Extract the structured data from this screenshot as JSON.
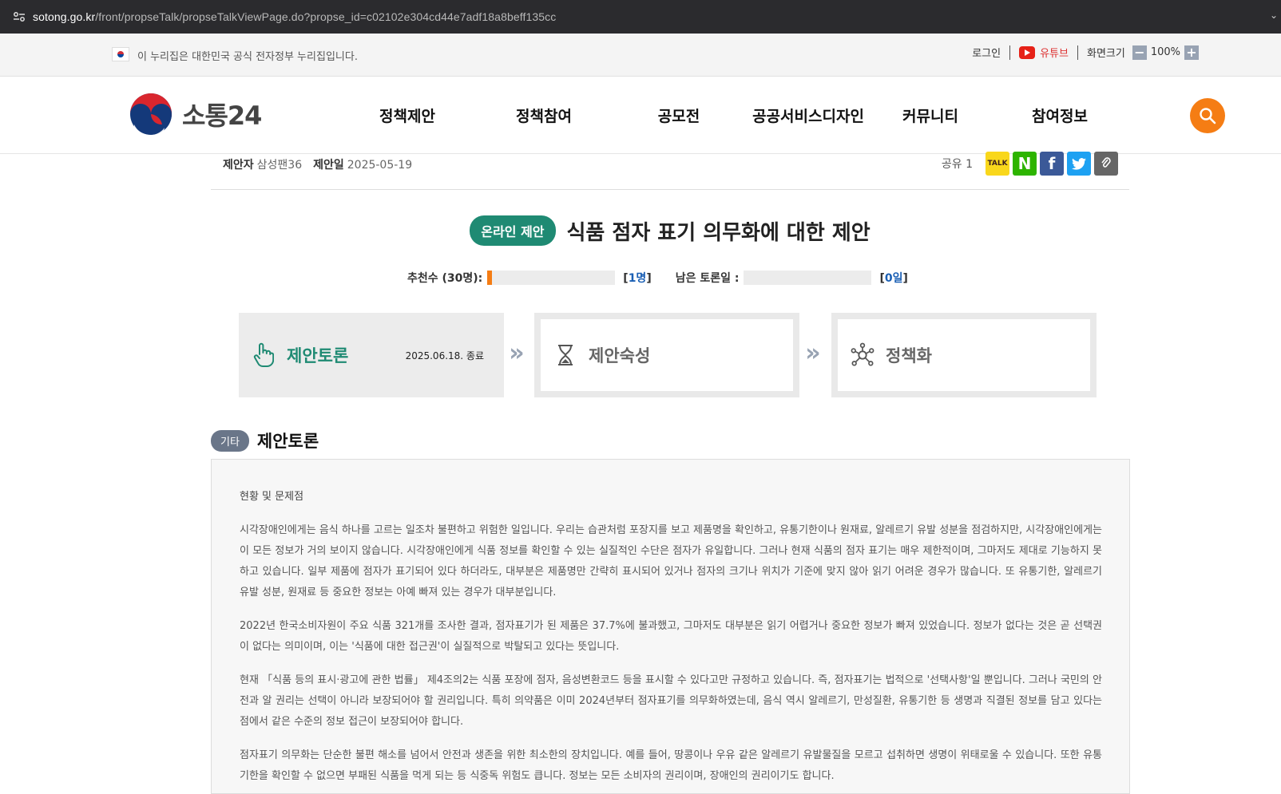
{
  "browser": {
    "url_host": "sotong.go.kr",
    "url_path": "/front/propseTalk/propseTalkViewPage.do?propse_id=c02102e304cd44e7adf18a8beff135cc"
  },
  "govbar": {
    "text": "이 누리집은 대한민국 공식 전자정부 누리집입니다.",
    "login": "로그인",
    "youtube": "유튜브",
    "zoom_label": "화면크기",
    "zoom_minus": "−",
    "zoom_value": "100%",
    "zoom_plus": "+"
  },
  "header": {
    "brand": "소통24",
    "nav": [
      "정책제안",
      "정책참여",
      "공모전",
      "공공서비스디자인",
      "커뮤니티",
      "참여정보"
    ],
    "search_icon": "search-icon"
  },
  "meta": {
    "proposer_label": "제안자",
    "proposer": "삼성팬36",
    "date_label": "제안일",
    "date": "2025-05-19",
    "share_label": "공유",
    "share_count": "1",
    "share_icons": [
      "kakaotalk-icon",
      "naver-icon",
      "facebook-icon",
      "twitter-icon",
      "link-icon"
    ],
    "kakao_text": "TALK",
    "naver_text": "N",
    "facebook_text": "f"
  },
  "proposal": {
    "type_badge": "온라인 제안",
    "title": "식품 점자 표기 의무화에 대한 제안"
  },
  "stats": {
    "recommend_label": "추천수 (30명):",
    "recommend_open": "[",
    "recommend_count": "1명",
    "recommend_close": "]",
    "recommend_progress": 0.033,
    "remaining_label": "남은 토론일 :",
    "remaining_open": "[",
    "remaining_count": "0일",
    "remaining_close": "]",
    "remaining_progress": 0
  },
  "stages": [
    {
      "name": "제안토론",
      "date": "2025.06.18. 종료",
      "state": "active",
      "icon": "hand-pointer-icon"
    },
    {
      "name": "제안숙성",
      "date": "",
      "state": "inactive",
      "icon": "hourglass-icon"
    },
    {
      "name": "정책화",
      "date": "",
      "state": "inactive",
      "icon": "network-icon"
    }
  ],
  "arrow_glyph": "»",
  "section": {
    "category": "기타",
    "title": "제안토론",
    "heading": "현황 및 문제점",
    "paragraphs": [
      "시각장애인에게는 음식 하나를 고르는 일조차 불편하고 위험한 일입니다. 우리는 습관처럼 포장지를 보고 제품명을 확인하고, 유통기한이나 원재료, 알레르기 유발 성분을 점검하지만, 시각장애인에게는 이 모든 정보가 거의 보이지 않습니다. 시각장애인에게 식품 정보를 확인할 수 있는 실질적인 수단은 점자가 유일합니다. 그러나 현재 식품의 점자 표기는 매우 제한적이며, 그마저도 제대로 기능하지 못하고 있습니다. 일부 제품에 점자가 표기되어 있다 하더라도, 대부분은 제품명만 간략히 표시되어 있거나 점자의 크기나 위치가 기준에 맞지 않아 읽기 어려운 경우가 많습니다. 또 유통기한, 알레르기 유발 성분, 원재료 등 중요한 정보는 아예 빠져 있는 경우가 대부분입니다.",
      "2022년 한국소비자원이 주요 식품 321개를 조사한 결과, 점자표기가 된 제품은 37.7%에 불과했고, 그마저도 대부분은 읽기 어렵거나 중요한 정보가 빠져 있었습니다. 정보가 없다는 것은 곧 선택권이 없다는 의미이며, 이는 '식품에 대한 접근권'이 실질적으로 박탈되고 있다는 뜻입니다.",
      "현재 「식품 등의 표시·광고에 관한 법률」 제4조의2는 식품 포장에 점자, 음성변환코드 등을 표시할 수 있다고만 규정하고 있습니다. 즉, 점자표기는 법적으로 '선택사항'일 뿐입니다. 그러나 국민의 안전과 알 권리는 선택이 아니라 보장되어야 할 권리입니다. 특히 의약품은 이미 2024년부터 점자표기를 의무화하였는데, 음식 역시 알레르기, 만성질환, 유통기한 등 생명과 직결된 정보를 담고 있다는 점에서 같은 수준의 정보 접근이 보장되어야 합니다.",
      "점자표기 의무화는 단순한 불편 해소를 넘어서 안전과 생존을 위한 최소한의 장치입니다. 예를 들어, 땅콩이나 우유 같은 알레르기 유발물질을 모르고 섭취하면 생명이 위태로울 수 있습니다. 또한 유통기한을 확인할 수 없으면 부패된 식품을 먹게 되는 등 식중독 위험도 큽니다. 정보는 모든 소비자의 권리이며, 장애인의 권리이기도 합니다."
    ]
  },
  "colors": {
    "accent_green": "#1f8a73",
    "accent_orange": "#f57d14",
    "badge_gray": "#6a7689"
  }
}
